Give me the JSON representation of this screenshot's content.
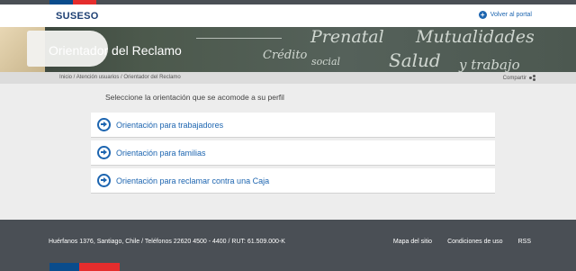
{
  "header": {
    "logo": "SUSESO",
    "back_link": "Volver al portal"
  },
  "banner": {
    "title": "Orientador del Reclamo",
    "chalk_words": [
      "Prenatal",
      "Mutualidades",
      "Crédito",
      "social",
      "Salud",
      "y trabajo"
    ]
  },
  "breadcrumb": [
    "Inicio /",
    "Atención usuarios /",
    "Orientador del Reclamo"
  ],
  "share_label": "Compartir",
  "prompt": "Seleccione la orientación que se acomode a su perfil",
  "options": [
    {
      "label": "Orientación para trabajadores"
    },
    {
      "label": "Orientación para familias"
    },
    {
      "label": "Orientación para reclamar contra una Caja"
    }
  ],
  "footer": {
    "address": "Huérfanos 1376, Santiago, Chile / Teléfonos 22620 4500 - 4400 / RUT: 61.509.000-K",
    "links": [
      "Mapa del sitio",
      "Condiciones de uso",
      "RSS"
    ]
  },
  "colors": {
    "brand_blue": "#1d65b0",
    "dark_gray": "#4a4f55",
    "accent_red": "#e52d2d",
    "flag_blue": "#0a4c8c"
  }
}
